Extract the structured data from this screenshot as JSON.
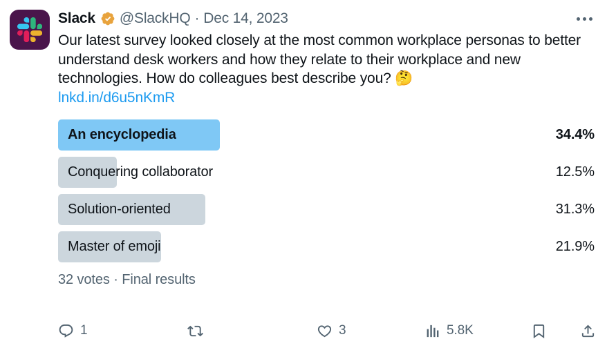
{
  "author": {
    "display_name": "Slack",
    "handle": "@SlackHQ",
    "separator": "·",
    "date": "Dec 14, 2023",
    "verified_badge": "verified-gold-badge",
    "avatar_alt": "slack-logo",
    "avatar_background": "#4a154b"
  },
  "more_menu": {
    "label": "More",
    "icon": "ellipsis-icon"
  },
  "tweet": {
    "text": "Our latest survey looked closely at the most common workplace personas to better understand desk workers and how they relate to their workplace and new technologies. How do colleagues best describe you? ",
    "emoji": "🤔",
    "link_text": "lnkd.in/d6u5nKmR",
    "link_color": "#1d9bf0"
  },
  "poll": {
    "options": [
      {
        "label": "An encyclopedia",
        "percent": "34.4%",
        "value": 34.4,
        "winner": true
      },
      {
        "label": "Conquering collaborator",
        "percent": "12.5%",
        "value": 12.5,
        "winner": false
      },
      {
        "label": "Solution-oriented",
        "percent": "31.3%",
        "value": 31.3,
        "winner": false
      },
      {
        "label": "Master of emoji",
        "percent": "21.9%",
        "value": 21.9,
        "winner": false
      }
    ],
    "winner_color": "#7fc8f5",
    "bar_color": "#ccd6dd",
    "votes_text": "32 votes · Final results",
    "vote_count": 32,
    "status": "Final results"
  },
  "actions": {
    "reply": {
      "icon": "reply-icon",
      "count": "1"
    },
    "retweet": {
      "icon": "retweet-icon",
      "count": ""
    },
    "like": {
      "icon": "heart-icon",
      "count": "3"
    },
    "views": {
      "icon": "analytics-icon",
      "count": "5.8K"
    },
    "bookmark": {
      "icon": "bookmark-icon",
      "count": ""
    },
    "share": {
      "icon": "share-icon",
      "count": ""
    }
  },
  "colors": {
    "text_primary": "#0f1419",
    "text_secondary": "#536471",
    "accent": "#1d9bf0"
  }
}
